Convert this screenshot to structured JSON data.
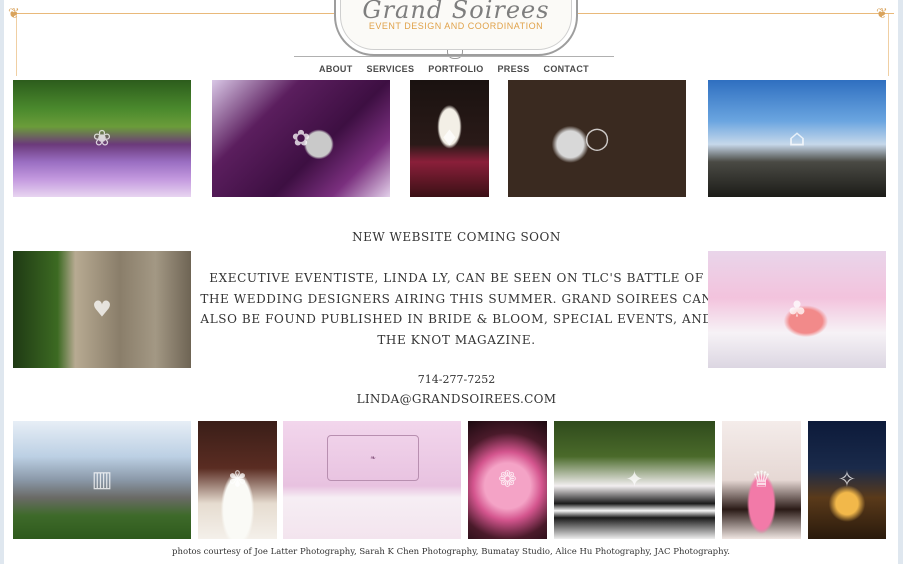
{
  "brand": {
    "title": "Grand Soirees",
    "subtitle": "EVENT DESIGN AND COORDINATION"
  },
  "nav": {
    "items": [
      {
        "label": "ABOUT"
      },
      {
        "label": "SERVICES"
      },
      {
        "label": "PORTFOLIO"
      },
      {
        "label": "PRESS"
      },
      {
        "label": "CONTACT"
      }
    ]
  },
  "content": {
    "headline": "NEW WEBSITE COMING SOON",
    "body": "EXECUTIVE EVENTISTE, LINDA LY, CAN BE SEEN ON TLC'S BATTLE OF THE WEDDING DESIGNERS AIRING THIS SUMMER. GRAND SOIREES CAN ALSO BE FOUND PUBLISHED IN BRIDE & BLOOM, SPECIAL EVENTS, AND THE KNOT MAGAZINE.",
    "phone": "714-277-7252",
    "email": "LINDA@GRANDSOIREES.COM"
  },
  "footer": {
    "credits": "photos courtesy of Joe Latter Photography, Sarah K Chen Photography, Bumatay Studio, Alice Hu Photography, JAC Photography."
  },
  "colors": {
    "accent_gold": "#e0a24a",
    "text": "#333333",
    "background": "#dfe7ef"
  }
}
